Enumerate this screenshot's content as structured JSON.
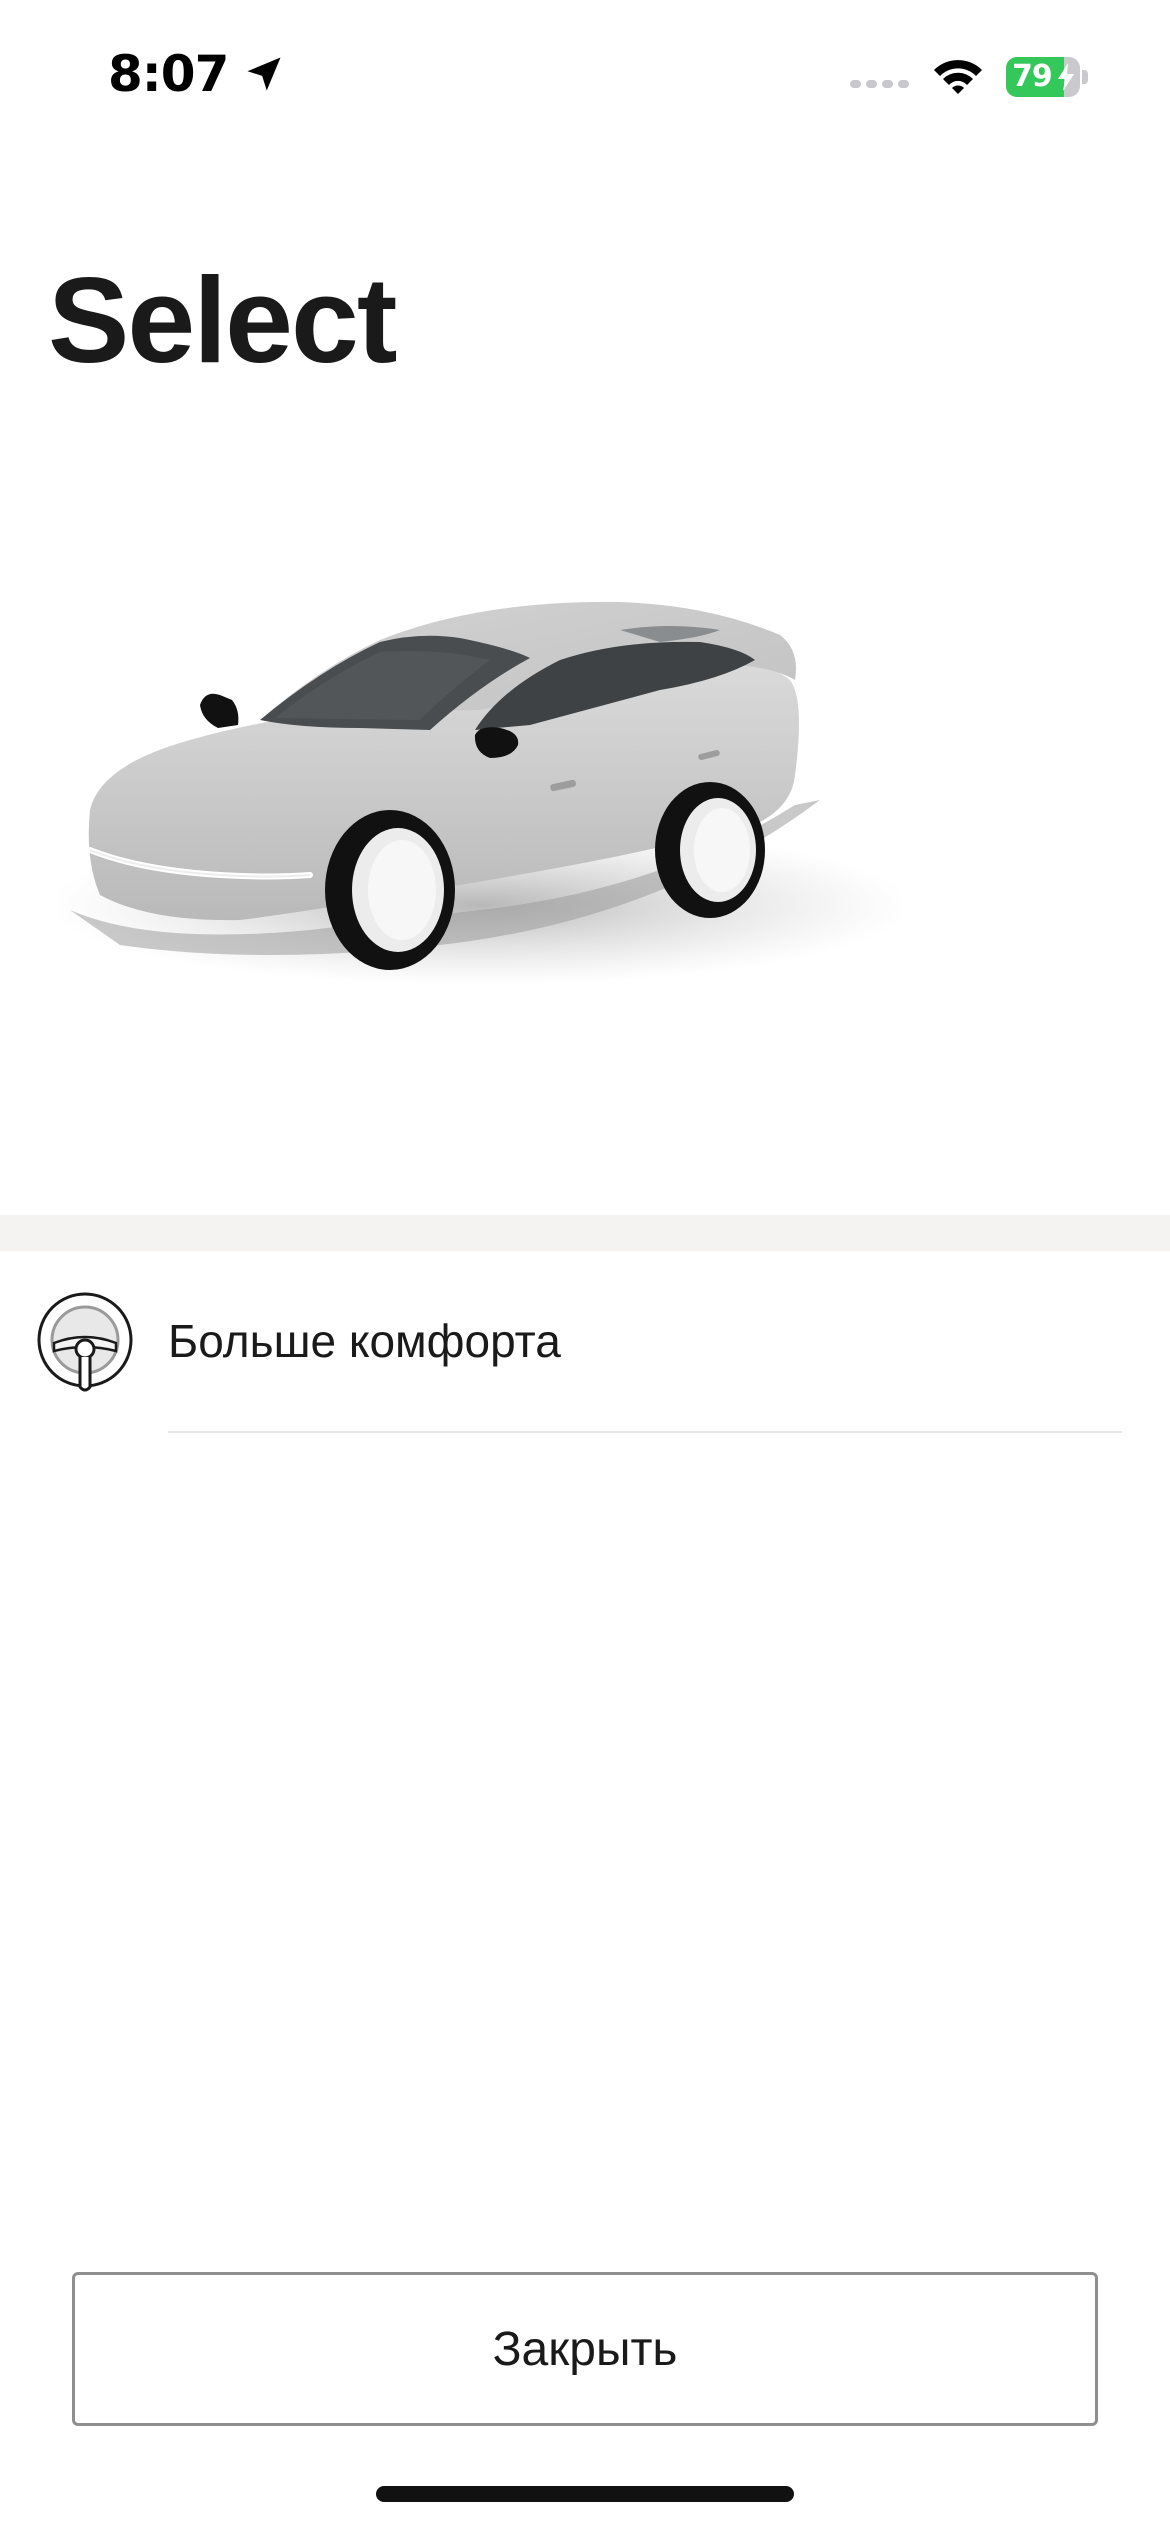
{
  "status_bar": {
    "time": "8:07",
    "battery_percent": "79",
    "battery_level": 0.79,
    "battery_color": "#34c759",
    "icons": [
      "location-arrow-icon",
      "cellular-signal-icon",
      "wifi-icon",
      "battery-charging-icon"
    ]
  },
  "page": {
    "title": "Select"
  },
  "hero": {
    "image": "white-sedan-car-illustration"
  },
  "features": [
    {
      "icon": "steering-wheel-icon",
      "label": "Больше комфорта"
    }
  ],
  "actions": {
    "close_label": "Закрыть"
  },
  "colors": {
    "text": "#1a1a1a",
    "band": "#f4f3f1",
    "divider": "#e6e6e6",
    "button_border": "#8f8f8f"
  }
}
